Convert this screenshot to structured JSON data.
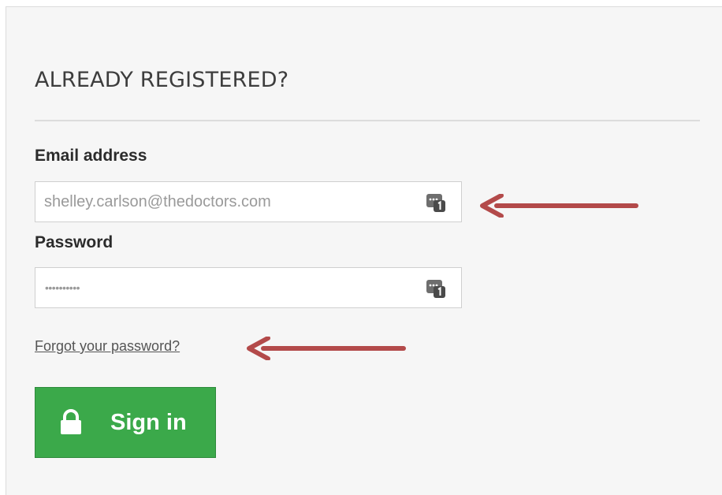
{
  "login": {
    "heading": "ALREADY REGISTERED?",
    "email_label": "Email address",
    "email_value": "shelley.carlson@thedoctors.com",
    "password_label": "Password",
    "password_mask": "••••••••••",
    "forgot_link": "Forgot your password?",
    "signin_label": "Sign in"
  },
  "icons": {
    "field_icon": "password-manager-icon",
    "button_icon": "lock-icon",
    "annotation": "arrow-left-icon"
  },
  "colors": {
    "panel_background": "#f6f6f6",
    "button_green": "#3ba94a",
    "annotation_arrow": "#b34a4a",
    "heading_text": "#3d3d3d"
  }
}
